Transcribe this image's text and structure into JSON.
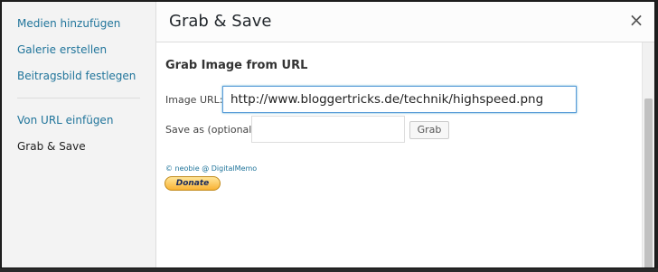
{
  "sidebar": {
    "items": [
      {
        "label": "Medien hinzufügen"
      },
      {
        "label": "Galerie erstellen"
      },
      {
        "label": "Beitragsbild festlegen"
      },
      {
        "label": "Von URL einfügen"
      },
      {
        "label": "Grab & Save"
      }
    ]
  },
  "header": {
    "title": "Grab & Save",
    "close_glyph": "×"
  },
  "form": {
    "section_title": "Grab Image from URL",
    "image_url_label": "Image URL:",
    "image_url_value": "http://www.bloggertricks.de/technik/highspeed.png",
    "save_as_label": "Save as (optional)",
    "save_as_value": "",
    "grab_label": "Grab",
    "credit": "© neobie @ DigitalMemo",
    "donate_label": "Donate"
  },
  "colors": {
    "link": "#21759b",
    "focus_border": "#5b9dd9",
    "donate_bg": "#f9b233"
  }
}
